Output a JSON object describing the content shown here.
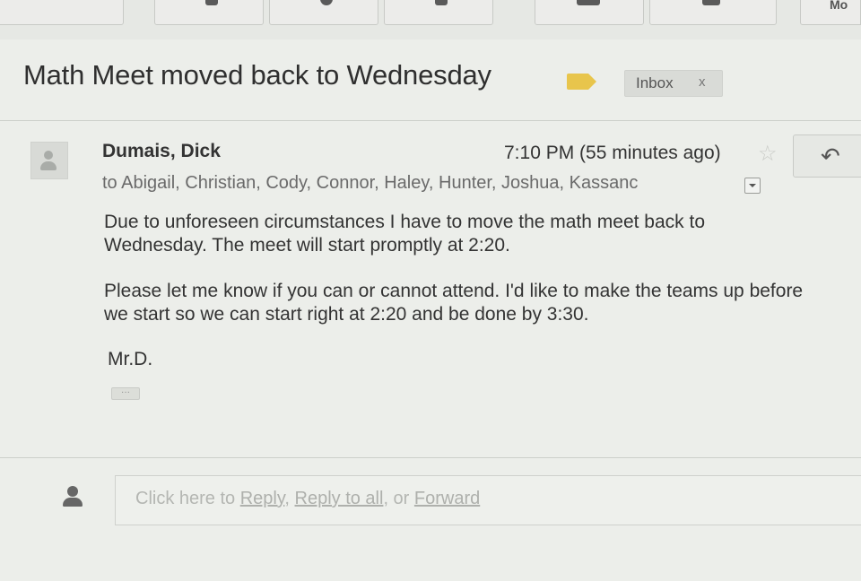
{
  "toolbar": {
    "more_label": "Mo"
  },
  "thread": {
    "subject": "Math Meet moved back to Wednesday",
    "label_color": "#e8c54c",
    "inbox_label": "Inbox",
    "inbox_remove": "x"
  },
  "message": {
    "sender": "Dumais, Dick",
    "time": "7:10 PM (55 minutes ago)",
    "recipients": "to Abigail, Christian, Cody, Connor, Haley, Hunter, Joshua, Kassanc",
    "paragraph1": "Due to unforeseen circumstances I have to move the math meet back to Wednesday. The meet will start promptly at 2:20.",
    "paragraph2": "Please let me know if you can or cannot attend. I'd like to make the teams up before we start so we can start right at 2:20 and be done by 3:30.",
    "signature": "Mr.D.",
    "quoted_toggle": "···"
  },
  "reply_bar": {
    "prefix": "Click here to ",
    "reply": "Reply",
    "sep1": ", ",
    "reply_all": "Reply to all",
    "sep2": ", or ",
    "forward": "Forward"
  },
  "icons": {
    "star": "star-icon",
    "reply": "reply-icon",
    "avatar": "person-icon"
  }
}
